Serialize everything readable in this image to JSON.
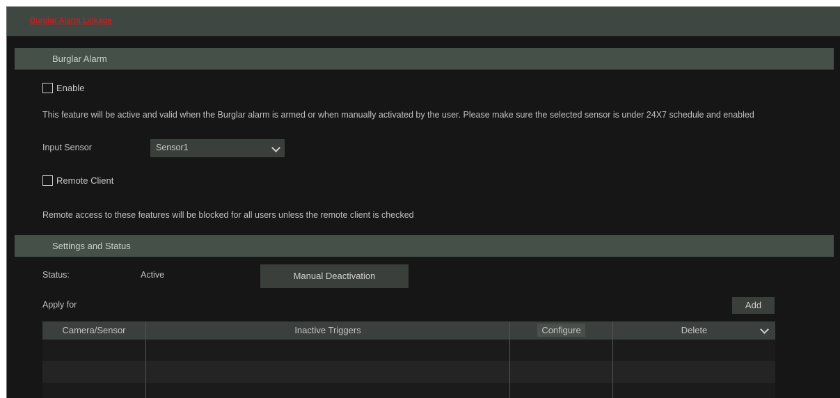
{
  "top_tab": {
    "label": "Burglar Alarm Linkage"
  },
  "burglar_section": {
    "title": "Burglar Alarm",
    "enable_label": "Enable",
    "enable_checked": false,
    "description": "This feature will be active and valid when the Burglar alarm is armed or when manually activated by the user. Please make sure the selected sensor is under 24X7 schedule and enabled",
    "input_sensor_label": "Input Sensor",
    "input_sensor_value": "Sensor1",
    "remote_client_label": "Remote Client",
    "remote_client_checked": false,
    "remote_note": "Remote access to these features will be blocked for all users unless the remote client is checked"
  },
  "status_section": {
    "title": "Settings and Status",
    "status_label": "Status:",
    "status_value": "Active",
    "manual_button": "Manual Deactivation",
    "apply_for_label": "Apply for",
    "add_button": "Add"
  },
  "table": {
    "columns": [
      "Camera/Sensor",
      "Inactive Triggers",
      "Configure",
      "Delete"
    ],
    "rows": [],
    "colors": {
      "header": "#3b3f3d",
      "row_alt": "#242424"
    }
  },
  "colors": {
    "accent_red": "#e0191e",
    "section_header": "#455049",
    "background": "#161616"
  }
}
